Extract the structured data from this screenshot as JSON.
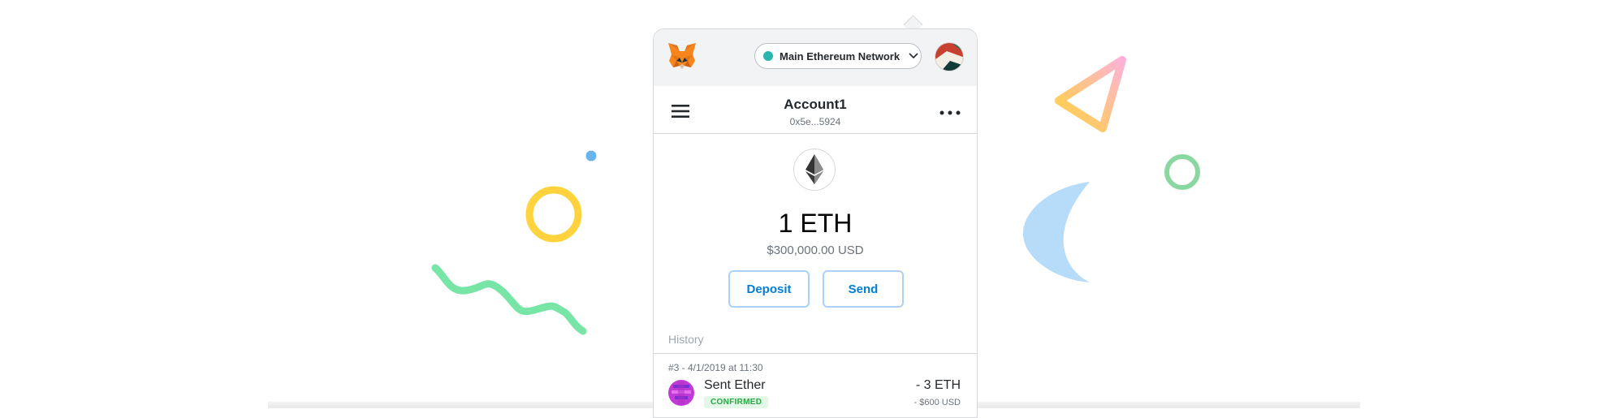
{
  "header": {
    "logo_icon": "metamask-fox-icon",
    "network_label": "Main Ethereum Network",
    "network_color": "#29b6af"
  },
  "account": {
    "name": "Account1",
    "address": "0x5e...5924"
  },
  "balance": {
    "token_icon": "ethereum-icon",
    "amount": "1 ETH",
    "fiat": "$300,000.00 USD"
  },
  "actions": {
    "deposit_label": "Deposit",
    "send_label": "Send"
  },
  "history": {
    "label": "History",
    "transactions": [
      {
        "meta": "#3 - 4/1/2019 at 11:30",
        "title": "Sent Ether",
        "status": "CONFIRMED",
        "amount": "- 3 ETH",
        "fiat": "- $600 USD"
      }
    ]
  },
  "colors": {
    "accent": "#037dd6",
    "button_border": "#abd1f5",
    "confirmed_bg": "#e3f8e7",
    "confirmed_text": "#28a745"
  }
}
